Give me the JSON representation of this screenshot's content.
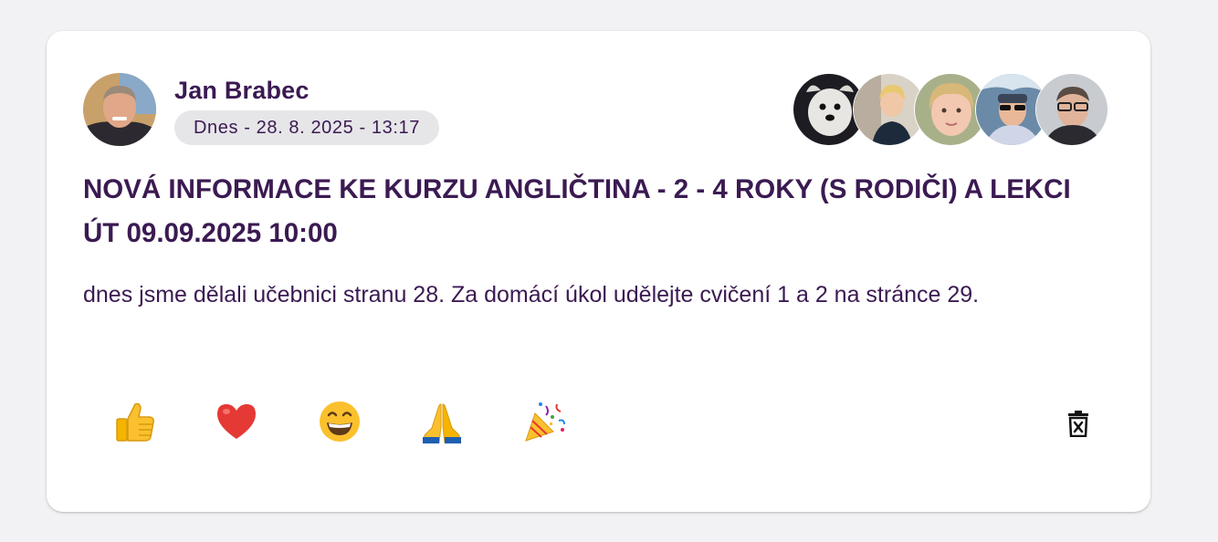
{
  "post": {
    "author": {
      "name": "Jan Brabec",
      "avatar": "author-photo"
    },
    "date": "Dnes - 28. 8. 2025 - 13:17",
    "title": "NOVÁ INFORMACE KE KURZU ANGLIČTINA - 2 - 4 ROKY (S RODIČI) A LEKCI ÚT 09.09.2025 10:00",
    "body": "dnes jsme dělali učebnici stranu 28. Za domácí úkol udělejte cvičení 1 a 2 na stránce 29.",
    "participants": [
      {
        "avatar": "dog-photo"
      },
      {
        "avatar": "child-photo"
      },
      {
        "avatar": "girl-photo"
      },
      {
        "avatar": "man-with-cap-photo"
      },
      {
        "avatar": "man-with-glasses-photo"
      }
    ],
    "reactions": [
      {
        "emoji": "👍",
        "icon": "thumbs-up-icon"
      },
      {
        "emoji": "❤️",
        "icon": "heart-icon"
      },
      {
        "emoji": "😄",
        "icon": "grinning-face-icon"
      },
      {
        "emoji": "🙏",
        "icon": "folded-hands-icon"
      },
      {
        "emoji": "🎉",
        "icon": "party-popper-icon"
      }
    ],
    "delete_icon": "delete-icon"
  },
  "colors": {
    "text": "#3b1a52",
    "chip_bg": "#e6e6e8",
    "page_bg": "#f2f2f4",
    "card_bg": "#ffffff"
  }
}
